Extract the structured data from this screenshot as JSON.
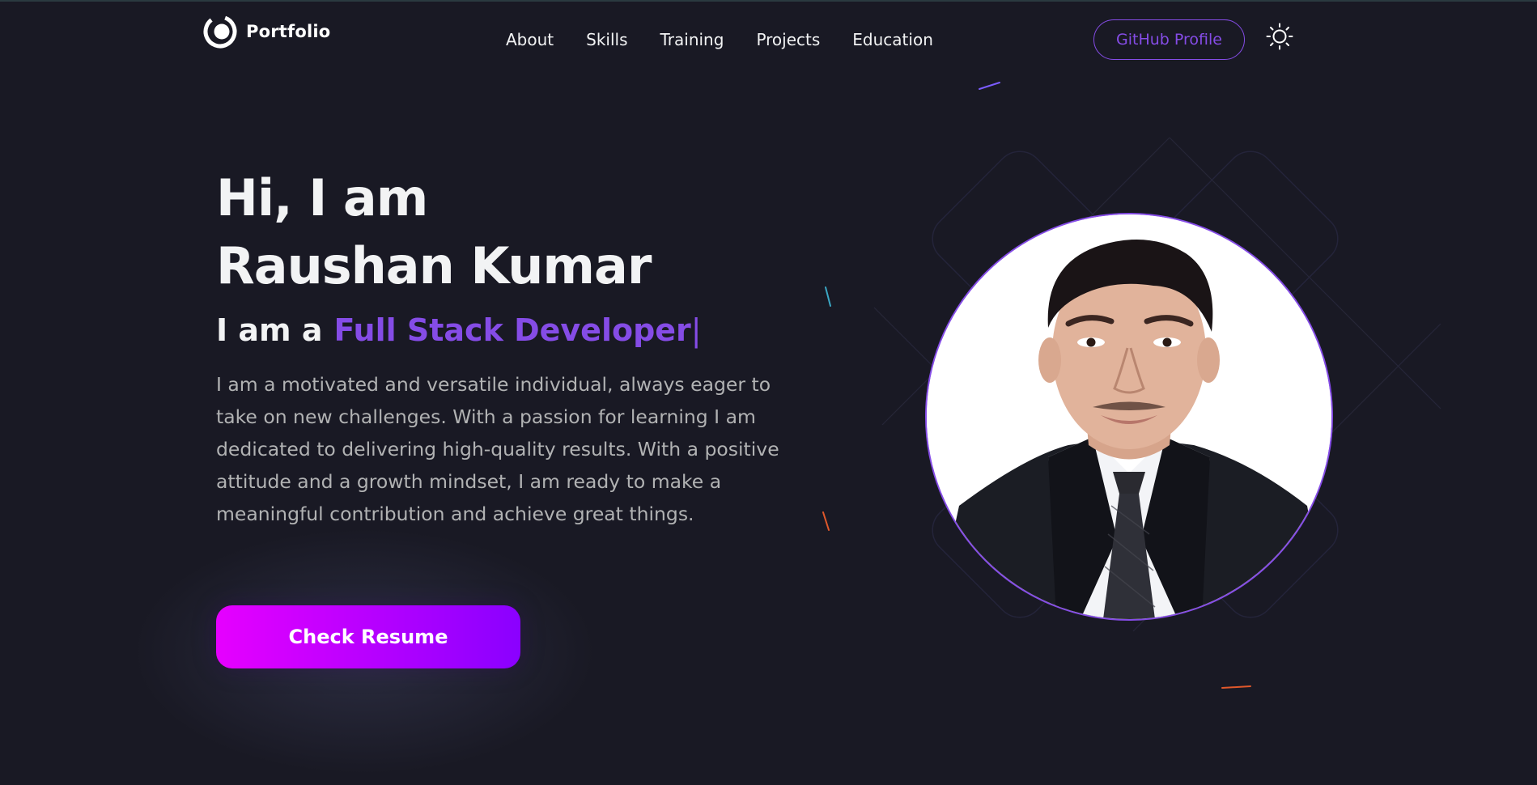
{
  "nav": {
    "logo_text": "Portfolio",
    "links": [
      "About",
      "Skills",
      "Training",
      "Projects",
      "Education"
    ],
    "github_label": "GitHub Profile",
    "theme_icon": "sun-icon"
  },
  "hero": {
    "greeting": "Hi, I am",
    "name": "Raushan Kumar",
    "role_prefix": "I am a",
    "role_value": "Full Stack Developer",
    "description": "I am a motivated and versatile individual, always eager to take on new challenges. With a passion for learning I am dedicated to delivering high-quality results. With a positive attitude and a growth mindset, I am ready to make a meaningful contribution and achieve great things.",
    "resume_label": "Check Resume"
  },
  "colors": {
    "background": "#191924",
    "accent": "#854ce6",
    "text_primary": "#f2f3f4",
    "text_secondary": "#b1b2b3",
    "button_gradient_start": "#e600ff",
    "button_gradient_end": "#8a00ff"
  }
}
